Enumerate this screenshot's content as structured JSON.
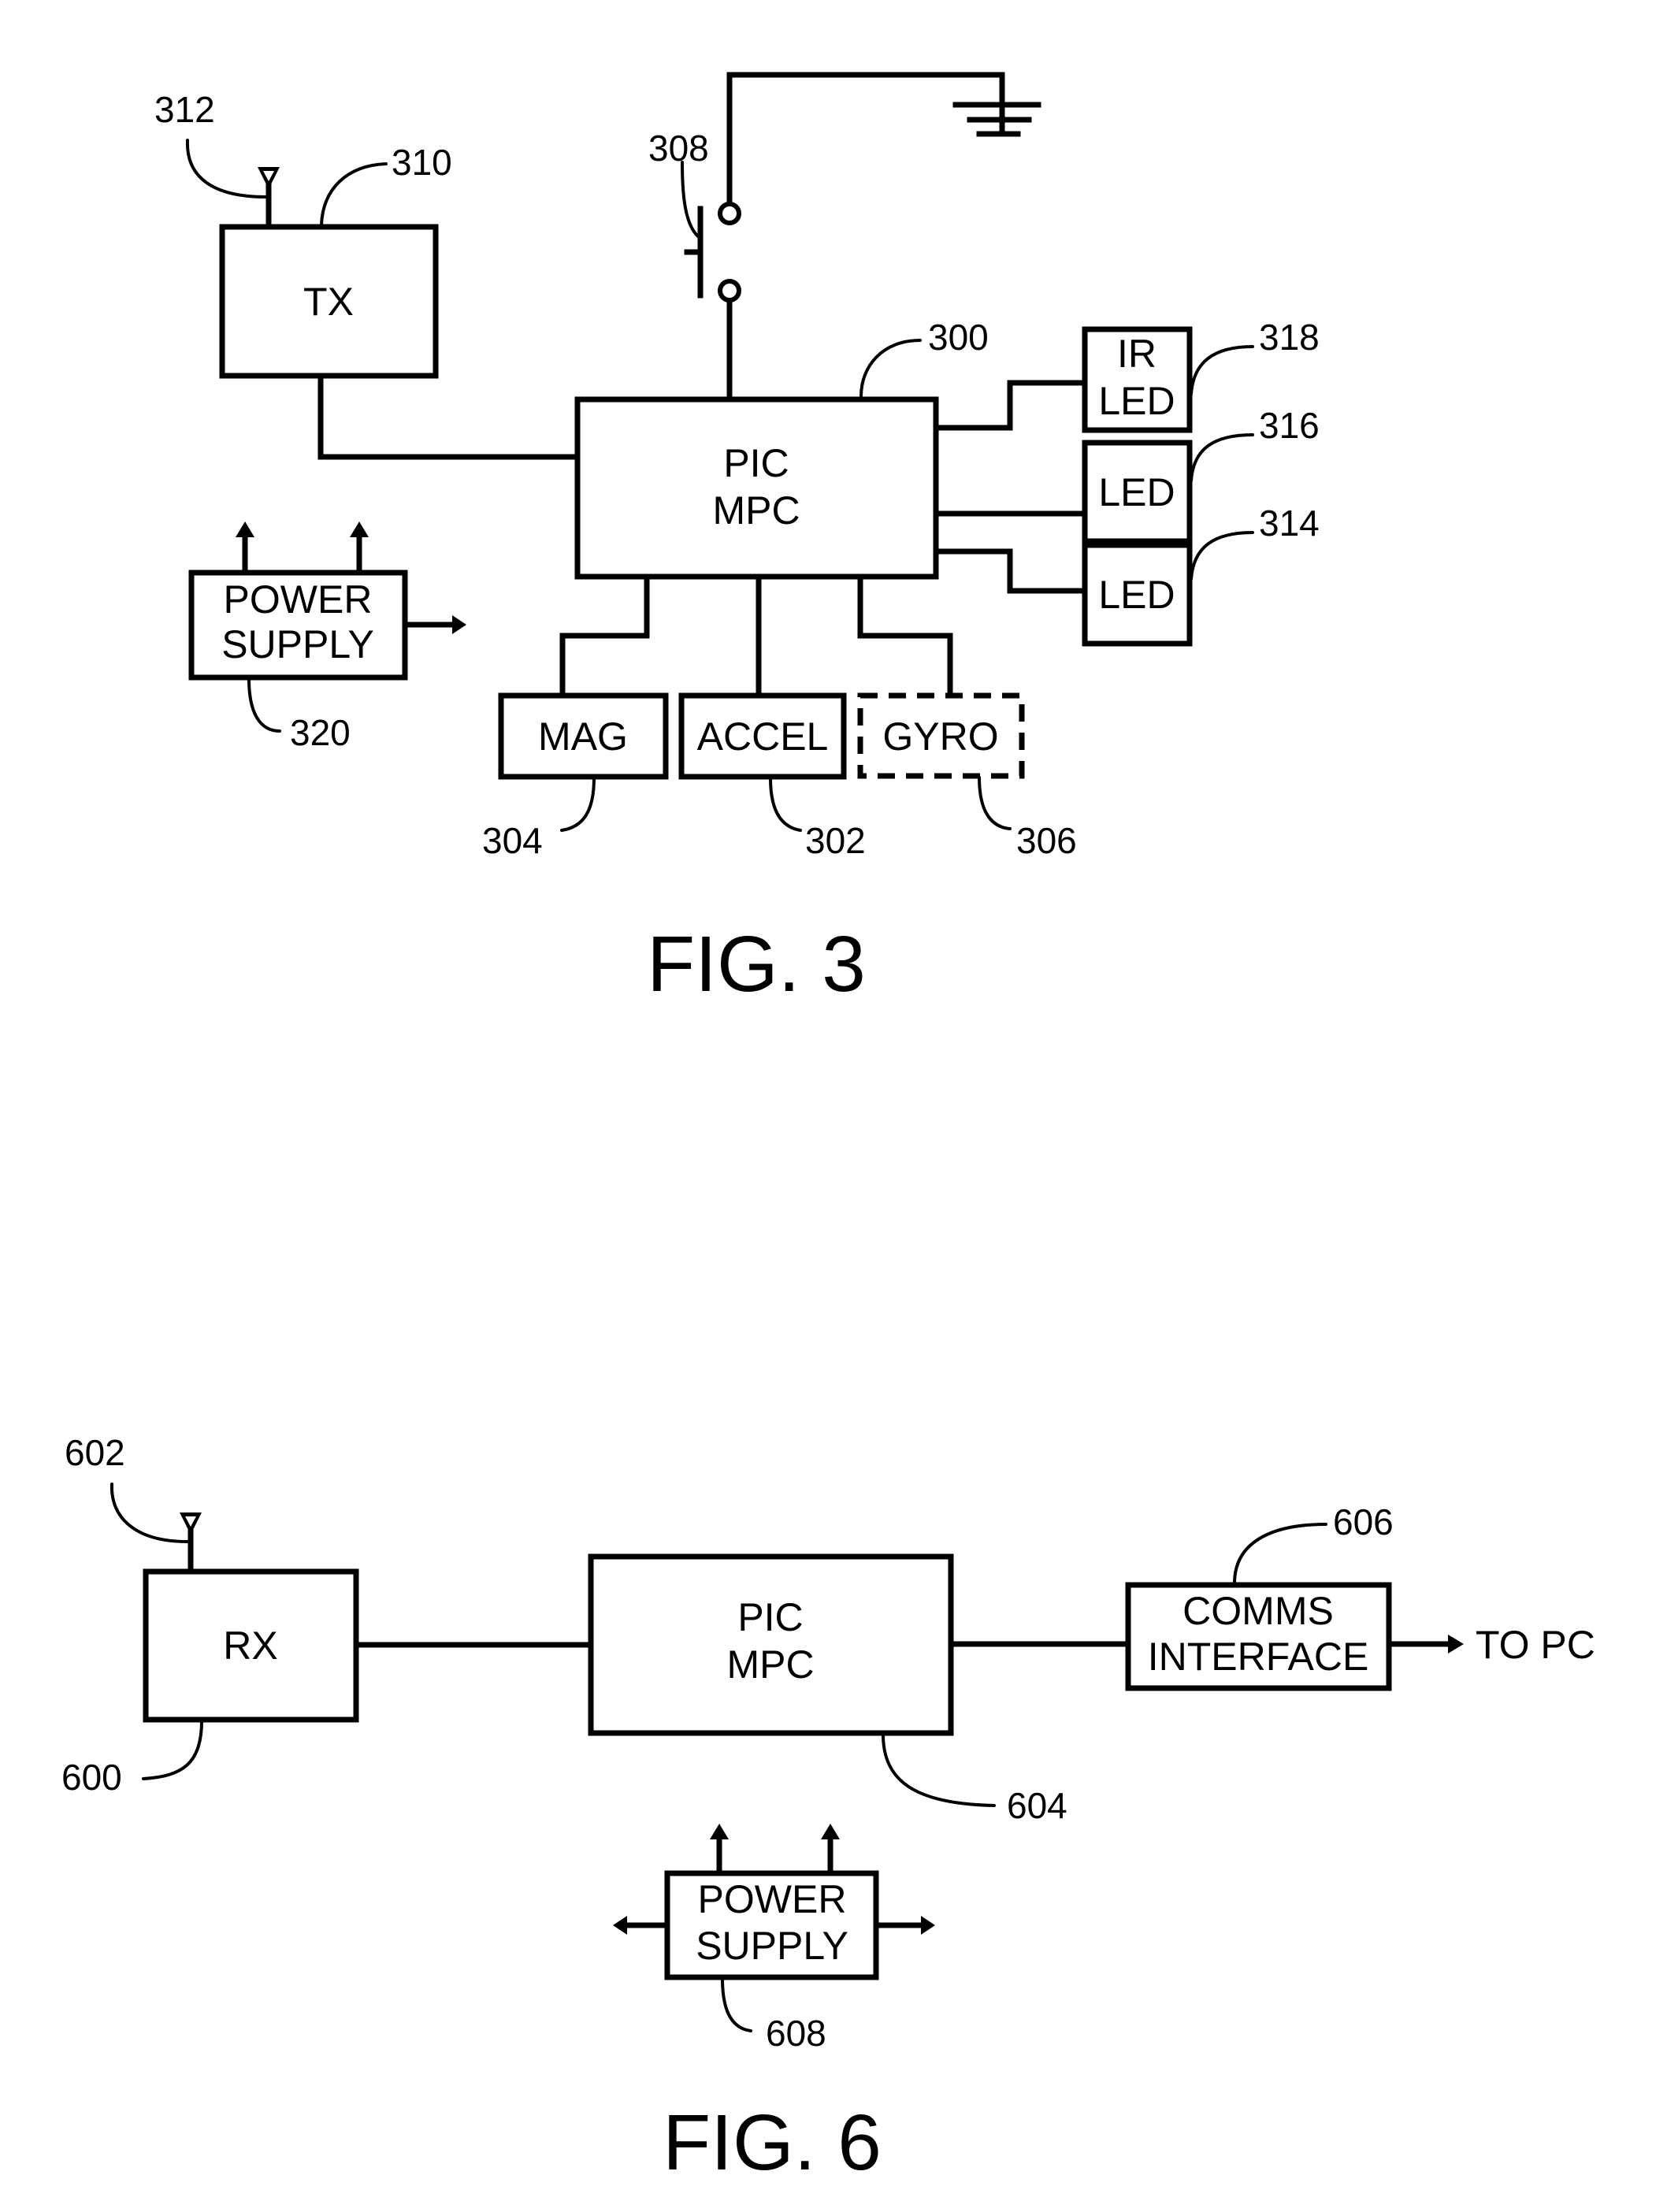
{
  "fig3": {
    "caption": "FIG. 3",
    "blocks": {
      "tx": "TX",
      "pic_line1": "PIC",
      "pic_line2": "MPC",
      "ir_led_line1": "IR",
      "ir_led_line2": "LED",
      "led_316": "LED",
      "led_314": "LED",
      "power_line1": "POWER",
      "power_line2": "SUPPLY",
      "mag": "MAG",
      "accel": "ACCEL",
      "gyro": "GYRO"
    },
    "refs": {
      "r312": "312",
      "r310": "310",
      "r308": "308",
      "r300": "300",
      "r318": "318",
      "r316": "316",
      "r314": "314",
      "r320": "320",
      "r304": "304",
      "r302": "302",
      "r306": "306"
    }
  },
  "fig6": {
    "caption": "FIG. 6",
    "blocks": {
      "rx": "RX",
      "pic_line1": "PIC",
      "pic_line2": "MPC",
      "comms_line1": "COMMS",
      "comms_line2": "INTERFACE",
      "to_pc": "TO PC",
      "power_line1": "POWER",
      "power_line2": "SUPPLY"
    },
    "refs": {
      "r602": "602",
      "r600": "600",
      "r604": "604",
      "r606": "606",
      "r608": "608"
    }
  }
}
